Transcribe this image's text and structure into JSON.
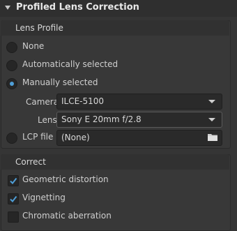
{
  "panel": {
    "title": "Profiled Lens Correction"
  },
  "lens_profile": {
    "title": "Lens Profile",
    "options": {
      "none": "None",
      "auto": "Automatically selected",
      "manual": "Manually selected"
    },
    "selected": "manual",
    "camera_label": "Camera",
    "camera_value": "ILCE-5100",
    "lens_label": "Lens",
    "lens_value": "Sony E 20mm f/2.8",
    "lcp_label": "LCP file",
    "lcp_value": "(None)"
  },
  "correct": {
    "title": "Correct",
    "geometric": {
      "label": "Geometric distortion",
      "checked": true
    },
    "vignetting": {
      "label": "Vignetting",
      "checked": true
    },
    "chromatic": {
      "label": "Chromatic aberration",
      "checked": false
    }
  },
  "colors": {
    "accent": "#4f9fd8",
    "background": "#353535"
  }
}
